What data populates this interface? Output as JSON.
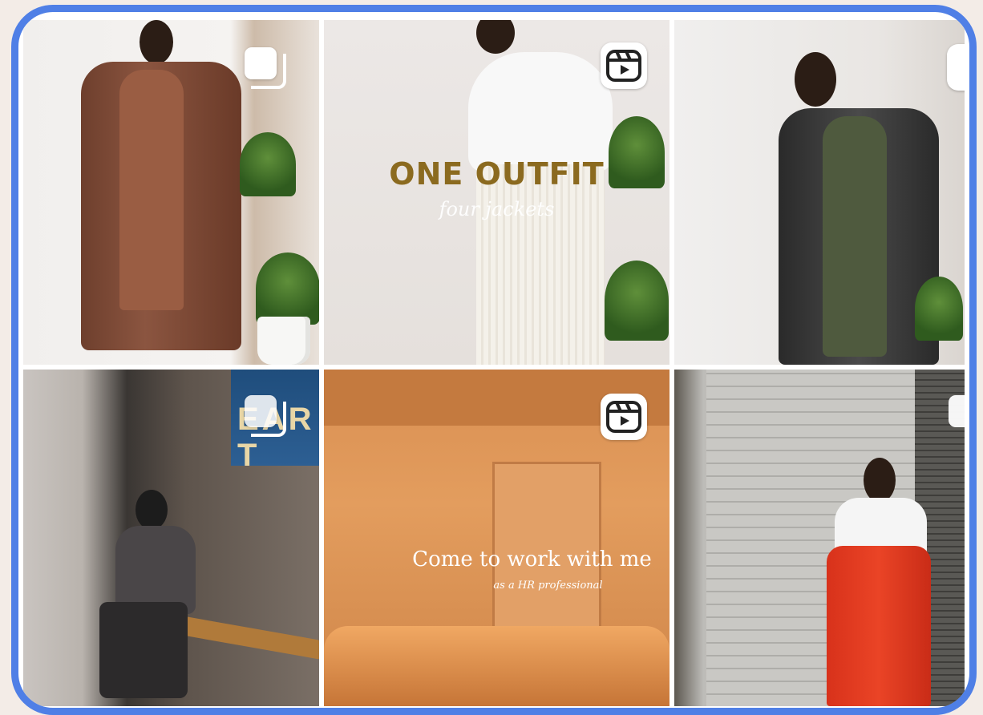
{
  "grid": {
    "tiles": [
      {
        "type": "carousel",
        "icon": "carousel-icon"
      },
      {
        "type": "reel",
        "icon": "reel-icon",
        "title": "ONE OUTFIT",
        "subtitle": "four jackets"
      },
      {
        "type": "reel",
        "icon": "reel-icon"
      },
      {
        "type": "carousel",
        "icon": "carousel-icon",
        "sign_text": "EAR T"
      },
      {
        "type": "reel",
        "icon": "reel-icon",
        "title": "Come to work with me",
        "subtitle": "as a HR professional"
      },
      {
        "type": "carousel",
        "icon": "carousel-icon"
      }
    ]
  },
  "colors": {
    "frame_border": "#4f7fe6",
    "title_gold": "#8b6a1f"
  }
}
